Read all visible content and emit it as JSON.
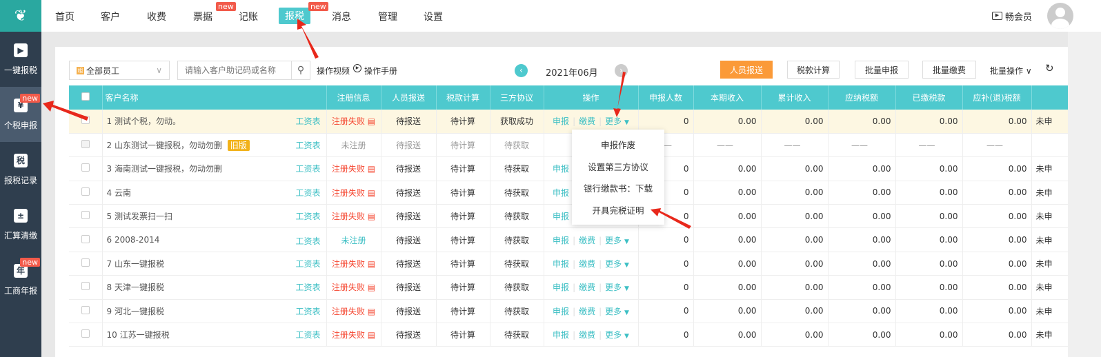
{
  "nav": [
    "首页",
    "客户",
    "收费",
    "票据",
    "记账",
    "报税",
    "消息",
    "管理",
    "设置"
  ],
  "new_badge": "new",
  "member": "畅会员",
  "sidebar": [
    {
      "label": "一键报税",
      "icon": "monitor-icon",
      "glyph": "▶"
    },
    {
      "label": "个税申报",
      "icon": "person-tax-icon",
      "glyph": "¥"
    },
    {
      "label": "报税记录",
      "icon": "tax-record-icon",
      "glyph": "税"
    },
    {
      "label": "汇算清缴",
      "icon": "calculator-icon",
      "glyph": "±"
    },
    {
      "label": "工商年报",
      "icon": "calendar-year-icon",
      "glyph": "年"
    }
  ],
  "toolbar": {
    "staff": "全部员工",
    "staff_icon": "组",
    "search_placeholder": "请输入客户助记码或名称",
    "video": "操作视频",
    "manual": "操作手册",
    "period": "2021年06月",
    "btn_report": "人员报送",
    "btn_calc": "税款计算",
    "btn_batch_declare": "批量申报",
    "btn_batch_pay": "批量缴费",
    "batch_ops": "批量操作"
  },
  "columns": [
    "客户名称",
    "注册信息",
    "人员报送",
    "税款计算",
    "三方协议",
    "操作",
    "申报人数",
    "本期收入",
    "累计收入",
    "应纳税额",
    "已缴税款",
    "应补(退)税额"
  ],
  "ops": {
    "declare": "申报",
    "pay": "缴费",
    "more": "更多"
  },
  "salary": "工资表",
  "old_badge": "旧版",
  "rows": [
    {
      "name": "1 测试个税，勿动。",
      "reg": "注册失败",
      "rp": "待报送",
      "calc": "待计算",
      "tri": "获取成功",
      "n": "0",
      "v": [
        "0.00",
        "0.00",
        "0.00",
        "0.00",
        "0.00"
      ],
      "last": "未申"
    },
    {
      "name": "2 山东测试一键报税，勿动勿删",
      "reg": "未注册",
      "rp": "待报送",
      "calc": "待计算",
      "tri": "待获取",
      "n": "——",
      "v": [
        "——",
        "——",
        "——",
        "——",
        "——"
      ],
      "last": ""
    },
    {
      "name": "3 海南测试一键报税，勿动勿删",
      "reg": "注册失败",
      "rp": "待报送",
      "calc": "待计算",
      "tri": "待获取",
      "n": "0",
      "v": [
        "0.00",
        "0.00",
        "0.00",
        "0.00",
        "0.00"
      ],
      "last": "未申"
    },
    {
      "name": "4 云南",
      "reg": "注册失败",
      "rp": "待报送",
      "calc": "待计算",
      "tri": "待获取",
      "n": "0",
      "v": [
        "0.00",
        "0.00",
        "0.00",
        "0.00",
        "0.00"
      ],
      "last": "未申"
    },
    {
      "name": "5 测试发票扫一扫",
      "reg": "注册失败",
      "rp": "待报送",
      "calc": "待计算",
      "tri": "待获取",
      "n": "0",
      "v": [
        "0.00",
        "0.00",
        "0.00",
        "0.00",
        "0.00"
      ],
      "last": "未申"
    },
    {
      "name": "6 2008-2014",
      "reg": "未注册",
      "rp": "待报送",
      "calc": "待计算",
      "tri": "待获取",
      "n": "0",
      "v": [
        "0.00",
        "0.00",
        "0.00",
        "0.00",
        "0.00"
      ],
      "last": "未申"
    },
    {
      "name": "7 山东一键报税",
      "reg": "注册失败",
      "rp": "待报送",
      "calc": "待计算",
      "tri": "待获取",
      "n": "0",
      "v": [
        "0.00",
        "0.00",
        "0.00",
        "0.00",
        "0.00"
      ],
      "last": "未申"
    },
    {
      "name": "8 天津一键报税",
      "reg": "注册失败",
      "rp": "待报送",
      "calc": "待计算",
      "tri": "待获取",
      "n": "0",
      "v": [
        "0.00",
        "0.00",
        "0.00",
        "0.00",
        "0.00"
      ],
      "last": "未申"
    },
    {
      "name": "9 河北一键报税",
      "reg": "注册失败",
      "rp": "待报送",
      "calc": "待计算",
      "tri": "待获取",
      "n": "0",
      "v": [
        "0.00",
        "0.00",
        "0.00",
        "0.00",
        "0.00"
      ],
      "last": "未申"
    },
    {
      "name": "10 江苏一键报税",
      "reg": "注册失败",
      "rp": "待报送",
      "calc": "待计算",
      "tri": "待获取",
      "n": "0",
      "v": [
        "0.00",
        "0.00",
        "0.00",
        "0.00",
        "0.00"
      ],
      "last": "未申"
    }
  ],
  "more_menu": [
    "申报作废",
    "设置第三方协议",
    "银行缴款书：下载",
    "开具完税证明"
  ]
}
